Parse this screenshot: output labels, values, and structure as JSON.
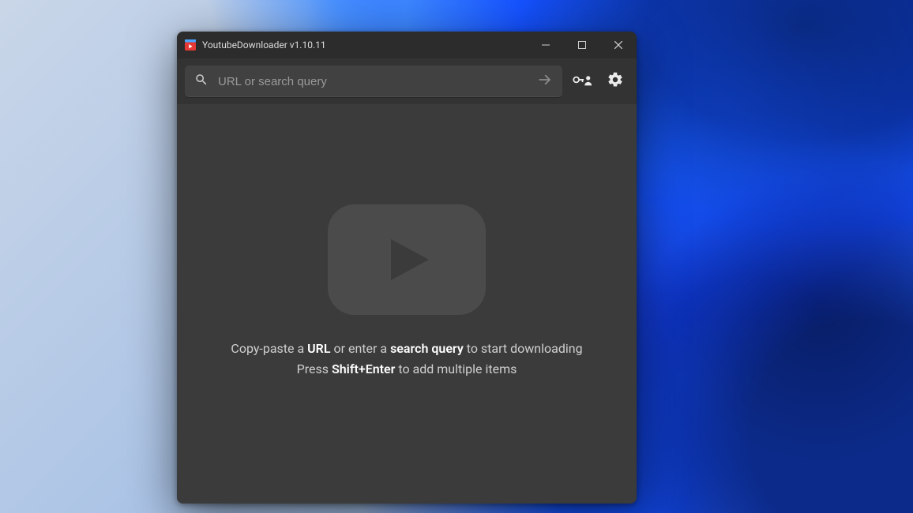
{
  "titlebar": {
    "title": "YoutubeDownloader v1.10.11"
  },
  "toolbar": {
    "search_placeholder": "URL or search query"
  },
  "hints": {
    "line1_pre": "Copy-paste a ",
    "line1_bold1": "URL",
    "line1_mid": " or enter a ",
    "line1_bold2": "search query",
    "line1_post": " to start downloading",
    "line2_pre": "Press ",
    "line2_bold": "Shift+Enter",
    "line2_post": " to add multiple items"
  }
}
